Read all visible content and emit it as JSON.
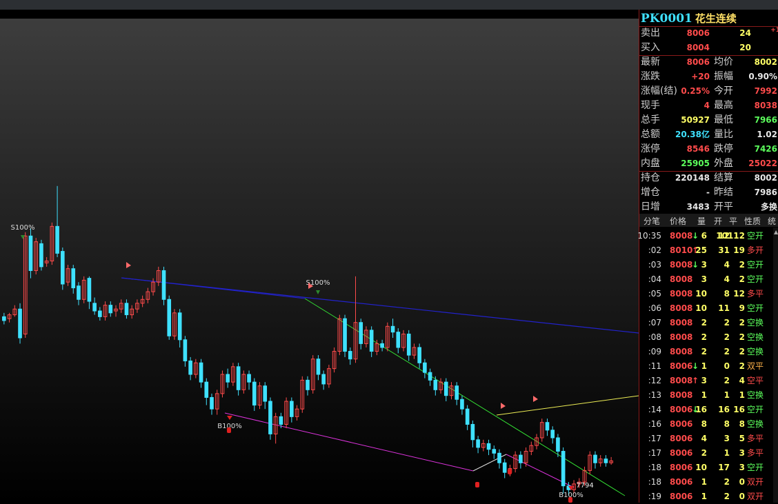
{
  "colors": {
    "up": "#ff4b4b",
    "down": "#3fe1ff",
    "yellow": "#ffff66",
    "green": "#5cff5c",
    "white": "#e8e8e8",
    "orange": "#ffb24a"
  },
  "quote": {
    "code": "PK0001",
    "name": "花生连续",
    "sell": {
      "label": "卖出",
      "price": "8006",
      "vol": "24",
      "extra": "+1"
    },
    "buy": {
      "label": "买入",
      "price": "8004",
      "vol": "20"
    },
    "rows": [
      {
        "l": "最新",
        "v1": "8006",
        "c1": "up",
        "l2": "均价",
        "v2": "8002",
        "c2": "yellow"
      },
      {
        "l": "涨跌",
        "v1": "+20",
        "c1": "up",
        "l2": "振幅",
        "v2": "0.90%",
        "c2": "white"
      },
      {
        "l": "涨幅(结)",
        "v1": "0.25%",
        "c1": "up",
        "l2": "今开",
        "v2": "7992",
        "c2": "up"
      },
      {
        "l": "现手",
        "v1": "4",
        "c1": "up",
        "l2": "最高",
        "v2": "8038",
        "c2": "up"
      },
      {
        "l": "总手",
        "v1": "50927",
        "c1": "yellow",
        "l2": "最低",
        "v2": "7966",
        "c2": "green"
      },
      {
        "l": "总额",
        "v1": "20.38亿",
        "c1": "down",
        "l2": "量比",
        "v2": "1.02",
        "c2": "white"
      },
      {
        "l": "涨停",
        "v1": "8546",
        "c1": "up",
        "l2": "跌停",
        "v2": "7426",
        "c2": "green"
      },
      {
        "l": "内盘",
        "v1": "25905",
        "c1": "green",
        "l2": "外盘",
        "v2": "25022",
        "c2": "up"
      },
      {
        "l": "持仓",
        "v1": "220148",
        "c1": "white",
        "l2": "结算",
        "v2": "8002",
        "c2": "white"
      },
      {
        "l": "增仓",
        "v1": "-",
        "c1": "white",
        "l2": "昨结",
        "v2": "7986",
        "c2": "white"
      },
      {
        "l": "日增",
        "v1": "3483",
        "c1": "white",
        "l2": "开平",
        "v2": "多换",
        "c2": "white"
      }
    ]
  },
  "ticks": {
    "headers": [
      "分笔",
      "价格",
      "量",
      "开",
      "平",
      "性质",
      "统"
    ],
    "rows": [
      {
        "t": "10:35",
        "p": "8008",
        "pc": "up",
        "ar": "↓",
        "ac": "green",
        "vol": "6",
        "op": "12",
        "cl": "10112",
        "nat": "空开",
        "nc": "green"
      },
      {
        "t": ":02",
        "p": "8010",
        "pc": "up",
        "ar": "↑",
        "ac": "up",
        "vol": "25",
        "op": "31",
        "cl": "19",
        "nat": "多开",
        "nc": "up"
      },
      {
        "t": ":03",
        "p": "8008",
        "pc": "up",
        "ar": "↓",
        "ac": "green",
        "vol": "3",
        "op": "4",
        "cl": "2",
        "nat": "空开",
        "nc": "green"
      },
      {
        "t": ":04",
        "p": "8008",
        "pc": "up",
        "ar": "",
        "ac": "",
        "vol": "3",
        "op": "4",
        "cl": "2",
        "nat": "空开",
        "nc": "green"
      },
      {
        "t": ":05",
        "p": "8008",
        "pc": "up",
        "ar": "",
        "ac": "",
        "vol": "10",
        "op": "8",
        "cl": "12",
        "nat": "多平",
        "nc": "up"
      },
      {
        "t": ":06",
        "p": "8008",
        "pc": "up",
        "ar": "",
        "ac": "",
        "vol": "10",
        "op": "11",
        "cl": "9",
        "nat": "空开",
        "nc": "green"
      },
      {
        "t": ":07",
        "p": "8008",
        "pc": "up",
        "ar": "",
        "ac": "",
        "vol": "2",
        "op": "2",
        "cl": "2",
        "nat": "空换",
        "nc": "green"
      },
      {
        "t": ":08",
        "p": "8008",
        "pc": "up",
        "ar": "",
        "ac": "",
        "vol": "2",
        "op": "2",
        "cl": "2",
        "nat": "空换",
        "nc": "green"
      },
      {
        "t": ":09",
        "p": "8008",
        "pc": "up",
        "ar": "",
        "ac": "",
        "vol": "2",
        "op": "2",
        "cl": "2",
        "nat": "空换",
        "nc": "green"
      },
      {
        "t": ":11",
        "p": "8006",
        "pc": "up",
        "ar": "↓",
        "ac": "green",
        "vol": "1",
        "op": "0",
        "cl": "2",
        "nat": "双平",
        "nc": "orange"
      },
      {
        "t": ":12",
        "p": "8008",
        "pc": "up",
        "ar": "↑",
        "ac": "up",
        "vol": "3",
        "op": "2",
        "cl": "4",
        "nat": "空平",
        "nc": "up"
      },
      {
        "t": ":13",
        "p": "8008",
        "pc": "up",
        "ar": "",
        "ac": "",
        "vol": "1",
        "op": "1",
        "cl": "1",
        "nat": "空换",
        "nc": "green"
      },
      {
        "t": ":14",
        "p": "8006",
        "pc": "up",
        "ar": "↓",
        "ac": "green",
        "vol": "16",
        "op": "16",
        "cl": "16",
        "nat": "空开",
        "nc": "green"
      },
      {
        "t": ":16",
        "p": "8006",
        "pc": "up",
        "ar": "",
        "ac": "",
        "vol": "8",
        "op": "8",
        "cl": "8",
        "nat": "空换",
        "nc": "green"
      },
      {
        "t": ":17",
        "p": "8006",
        "pc": "up",
        "ar": "",
        "ac": "",
        "vol": "4",
        "op": "3",
        "cl": "5",
        "nat": "多平",
        "nc": "up"
      },
      {
        "t": ":17",
        "p": "8006",
        "pc": "up",
        "ar": "",
        "ac": "",
        "vol": "2",
        "op": "1",
        "cl": "3",
        "nat": "多平",
        "nc": "up"
      },
      {
        "t": ":18",
        "p": "8006",
        "pc": "up",
        "ar": "",
        "ac": "",
        "vol": "10",
        "op": "17",
        "cl": "3",
        "nat": "空开",
        "nc": "green"
      },
      {
        "t": ":18",
        "p": "8006",
        "pc": "up",
        "ar": "",
        "ac": "",
        "vol": "1",
        "op": "2",
        "cl": "0",
        "nat": "双开",
        "nc": "up"
      },
      {
        "t": ":19",
        "p": "8006",
        "pc": "up",
        "ar": "",
        "ac": "",
        "vol": "1",
        "op": "2",
        "cl": "0",
        "nat": "双开",
        "nc": "up"
      }
    ]
  },
  "chart_data": {
    "type": "candlestick",
    "labels": [
      {
        "text": "S100%",
        "kind": "sell"
      },
      {
        "text": "S100%",
        "kind": "sell"
      },
      {
        "text": "B100%",
        "kind": "buy"
      },
      {
        "text": "B100%",
        "kind": "buy"
      },
      {
        "text": "7794",
        "kind": "low"
      }
    ],
    "candles": [
      [
        0.96,
        0.94,
        0.98,
        0.92
      ],
      [
        0.95,
        0.97,
        0.98,
        0.93
      ],
      [
        0.97,
        1.0,
        1.02,
        0.96
      ],
      [
        1.0,
        0.85,
        1.03,
        0.82
      ],
      [
        0.87,
        1.38,
        1.4,
        0.85
      ],
      [
        1.38,
        1.2,
        1.42,
        1.16
      ],
      [
        1.2,
        1.35,
        1.37,
        1.18
      ],
      [
        1.34,
        1.22,
        1.36,
        1.2
      ],
      [
        1.24,
        1.25,
        1.27,
        1.22
      ],
      [
        1.25,
        1.43,
        1.45,
        1.23
      ],
      [
        1.43,
        1.29,
        1.64,
        1.27
      ],
      [
        1.3,
        1.13,
        1.32,
        1.1
      ],
      [
        1.14,
        1.21,
        1.23,
        1.12
      ],
      [
        1.21,
        1.11,
        1.23,
        1.08
      ],
      [
        1.12,
        1.05,
        1.14,
        1.02
      ],
      [
        1.05,
        1.15,
        1.17,
        1.03
      ],
      [
        1.16,
        1.04,
        1.17,
        1.0
      ],
      [
        1.03,
        0.99,
        1.06,
        0.97
      ],
      [
        0.99,
        0.96,
        1.01,
        0.94
      ],
      [
        0.96,
        1.02,
        1.04,
        0.94
      ],
      [
        1.02,
        0.98,
        1.04,
        0.96
      ],
      [
        0.99,
        1.0,
        1.02,
        0.96
      ],
      [
        1.0,
        1.03,
        1.05,
        0.98
      ],
      [
        1.03,
        0.97,
        1.05,
        0.95
      ],
      [
        0.97,
        1.0,
        1.02,
        0.95
      ],
      [
        1.0,
        1.03,
        1.05,
        0.98
      ],
      [
        1.03,
        1.05,
        1.07,
        1.01
      ],
      [
        1.05,
        1.09,
        1.11,
        1.03
      ],
      [
        1.09,
        1.14,
        1.16,
        1.07
      ],
      [
        1.14,
        1.2,
        1.22,
        1.12
      ],
      [
        1.2,
        1.05,
        1.22,
        1.02
      ],
      [
        1.05,
        0.86,
        1.07,
        0.84
      ],
      [
        0.86,
        0.98,
        1.0,
        0.84
      ],
      [
        0.98,
        0.84,
        1.0,
        0.8
      ],
      [
        0.84,
        0.73,
        0.86,
        0.7
      ],
      [
        0.73,
        0.66,
        0.75,
        0.63
      ],
      [
        0.66,
        0.72,
        0.74,
        0.64
      ],
      [
        0.72,
        0.62,
        0.74,
        0.59
      ],
      [
        0.62,
        0.54,
        0.64,
        0.5
      ],
      [
        0.54,
        0.48,
        0.56,
        0.45
      ],
      [
        0.48,
        0.56,
        0.58,
        0.45
      ],
      [
        0.56,
        0.66,
        0.68,
        0.54
      ],
      [
        0.66,
        0.62,
        0.69,
        0.59
      ],
      [
        0.62,
        0.7,
        0.72,
        0.6
      ],
      [
        0.7,
        0.58,
        0.72,
        0.55
      ],
      [
        0.58,
        0.66,
        0.68,
        0.56
      ],
      [
        0.66,
        0.62,
        0.68,
        0.58
      ],
      [
        0.62,
        0.5,
        0.64,
        0.47
      ],
      [
        0.5,
        0.6,
        0.62,
        0.48
      ],
      [
        0.6,
        0.52,
        0.62,
        0.48
      ],
      [
        0.52,
        0.35,
        0.54,
        0.32
      ],
      [
        0.35,
        0.44,
        0.46,
        0.3
      ],
      [
        0.44,
        0.4,
        0.46,
        0.38
      ],
      [
        0.4,
        0.52,
        0.54,
        0.38
      ],
      [
        0.52,
        0.44,
        0.54,
        0.41
      ],
      [
        0.44,
        0.48,
        0.5,
        0.42
      ],
      [
        0.48,
        0.63,
        0.65,
        0.46
      ],
      [
        0.63,
        0.58,
        0.65,
        0.55
      ],
      [
        0.58,
        0.74,
        0.76,
        0.56
      ],
      [
        0.74,
        0.66,
        0.76,
        0.63
      ],
      [
        0.66,
        0.61,
        0.68,
        0.58
      ],
      [
        0.61,
        0.69,
        0.71,
        0.59
      ],
      [
        0.69,
        0.78,
        0.8,
        0.67
      ],
      [
        0.78,
        0.95,
        0.97,
        0.76
      ],
      [
        0.95,
        0.78,
        0.97,
        0.75
      ],
      [
        0.78,
        0.74,
        0.8,
        0.71
      ],
      [
        0.74,
        0.93,
        1.17,
        0.72
      ],
      [
        0.93,
        0.82,
        0.95,
        0.79
      ],
      [
        0.82,
        0.89,
        0.91,
        0.8
      ],
      [
        0.89,
        0.78,
        0.91,
        0.75
      ],
      [
        0.78,
        0.82,
        0.84,
        0.76
      ],
      [
        0.82,
        0.8,
        0.84,
        0.78
      ],
      [
        0.8,
        0.91,
        0.93,
        0.78
      ],
      [
        0.91,
        0.88,
        0.95,
        0.85
      ],
      [
        0.88,
        0.8,
        0.9,
        0.77
      ],
      [
        0.8,
        0.87,
        0.89,
        0.78
      ],
      [
        0.87,
        0.76,
        0.89,
        0.73
      ],
      [
        0.76,
        0.8,
        0.82,
        0.74
      ],
      [
        0.8,
        0.72,
        0.82,
        0.69
      ],
      [
        0.72,
        0.67,
        0.74,
        0.64
      ],
      [
        0.67,
        0.63,
        0.69,
        0.6
      ],
      [
        0.63,
        0.58,
        0.65,
        0.55
      ],
      [
        0.58,
        0.62,
        0.64,
        0.56
      ],
      [
        0.62,
        0.55,
        0.64,
        0.52
      ],
      [
        0.55,
        0.6,
        0.62,
        0.53
      ],
      [
        0.6,
        0.53,
        0.62,
        0.5
      ],
      [
        0.53,
        0.48,
        0.55,
        0.45
      ],
      [
        0.48,
        0.4,
        0.5,
        0.37
      ],
      [
        0.4,
        0.32,
        0.42,
        0.28
      ],
      [
        0.32,
        0.28,
        0.34,
        0.25
      ],
      [
        0.28,
        0.3,
        0.32,
        0.26
      ],
      [
        0.3,
        0.27,
        0.32,
        0.24
      ],
      [
        0.27,
        0.25,
        0.29,
        0.22
      ],
      [
        0.25,
        0.2,
        0.27,
        0.17
      ],
      [
        0.2,
        0.15,
        0.22,
        0.12
      ],
      [
        0.15,
        0.17,
        0.19,
        0.13
      ],
      [
        0.17,
        0.24,
        0.26,
        0.15
      ],
      [
        0.24,
        0.2,
        0.26,
        0.17
      ],
      [
        0.2,
        0.26,
        0.28,
        0.18
      ],
      [
        0.26,
        0.29,
        0.31,
        0.24
      ],
      [
        0.29,
        0.33,
        0.35,
        0.27
      ],
      [
        0.33,
        0.41,
        0.43,
        0.31
      ],
      [
        0.41,
        0.37,
        0.43,
        0.34
      ],
      [
        0.37,
        0.33,
        0.39,
        0.3
      ],
      [
        0.33,
        0.26,
        0.35,
        0.23
      ],
      [
        0.26,
        0.08,
        0.28,
        0.04
      ],
      [
        0.08,
        0.06,
        0.1,
        0.03
      ],
      [
        0.06,
        0.09,
        0.11,
        0.04
      ],
      [
        0.09,
        0.1,
        0.12,
        0.07
      ],
      [
        0.1,
        0.16,
        0.18,
        0.08
      ],
      [
        0.16,
        0.24,
        0.26,
        0.14
      ],
      [
        0.24,
        0.2,
        0.26,
        0.17
      ],
      [
        0.2,
        0.22,
        0.24,
        0.18
      ],
      [
        0.22,
        0.2,
        0.24,
        0.18
      ],
      [
        0.2,
        0.21,
        0.23,
        0.19
      ]
    ]
  }
}
